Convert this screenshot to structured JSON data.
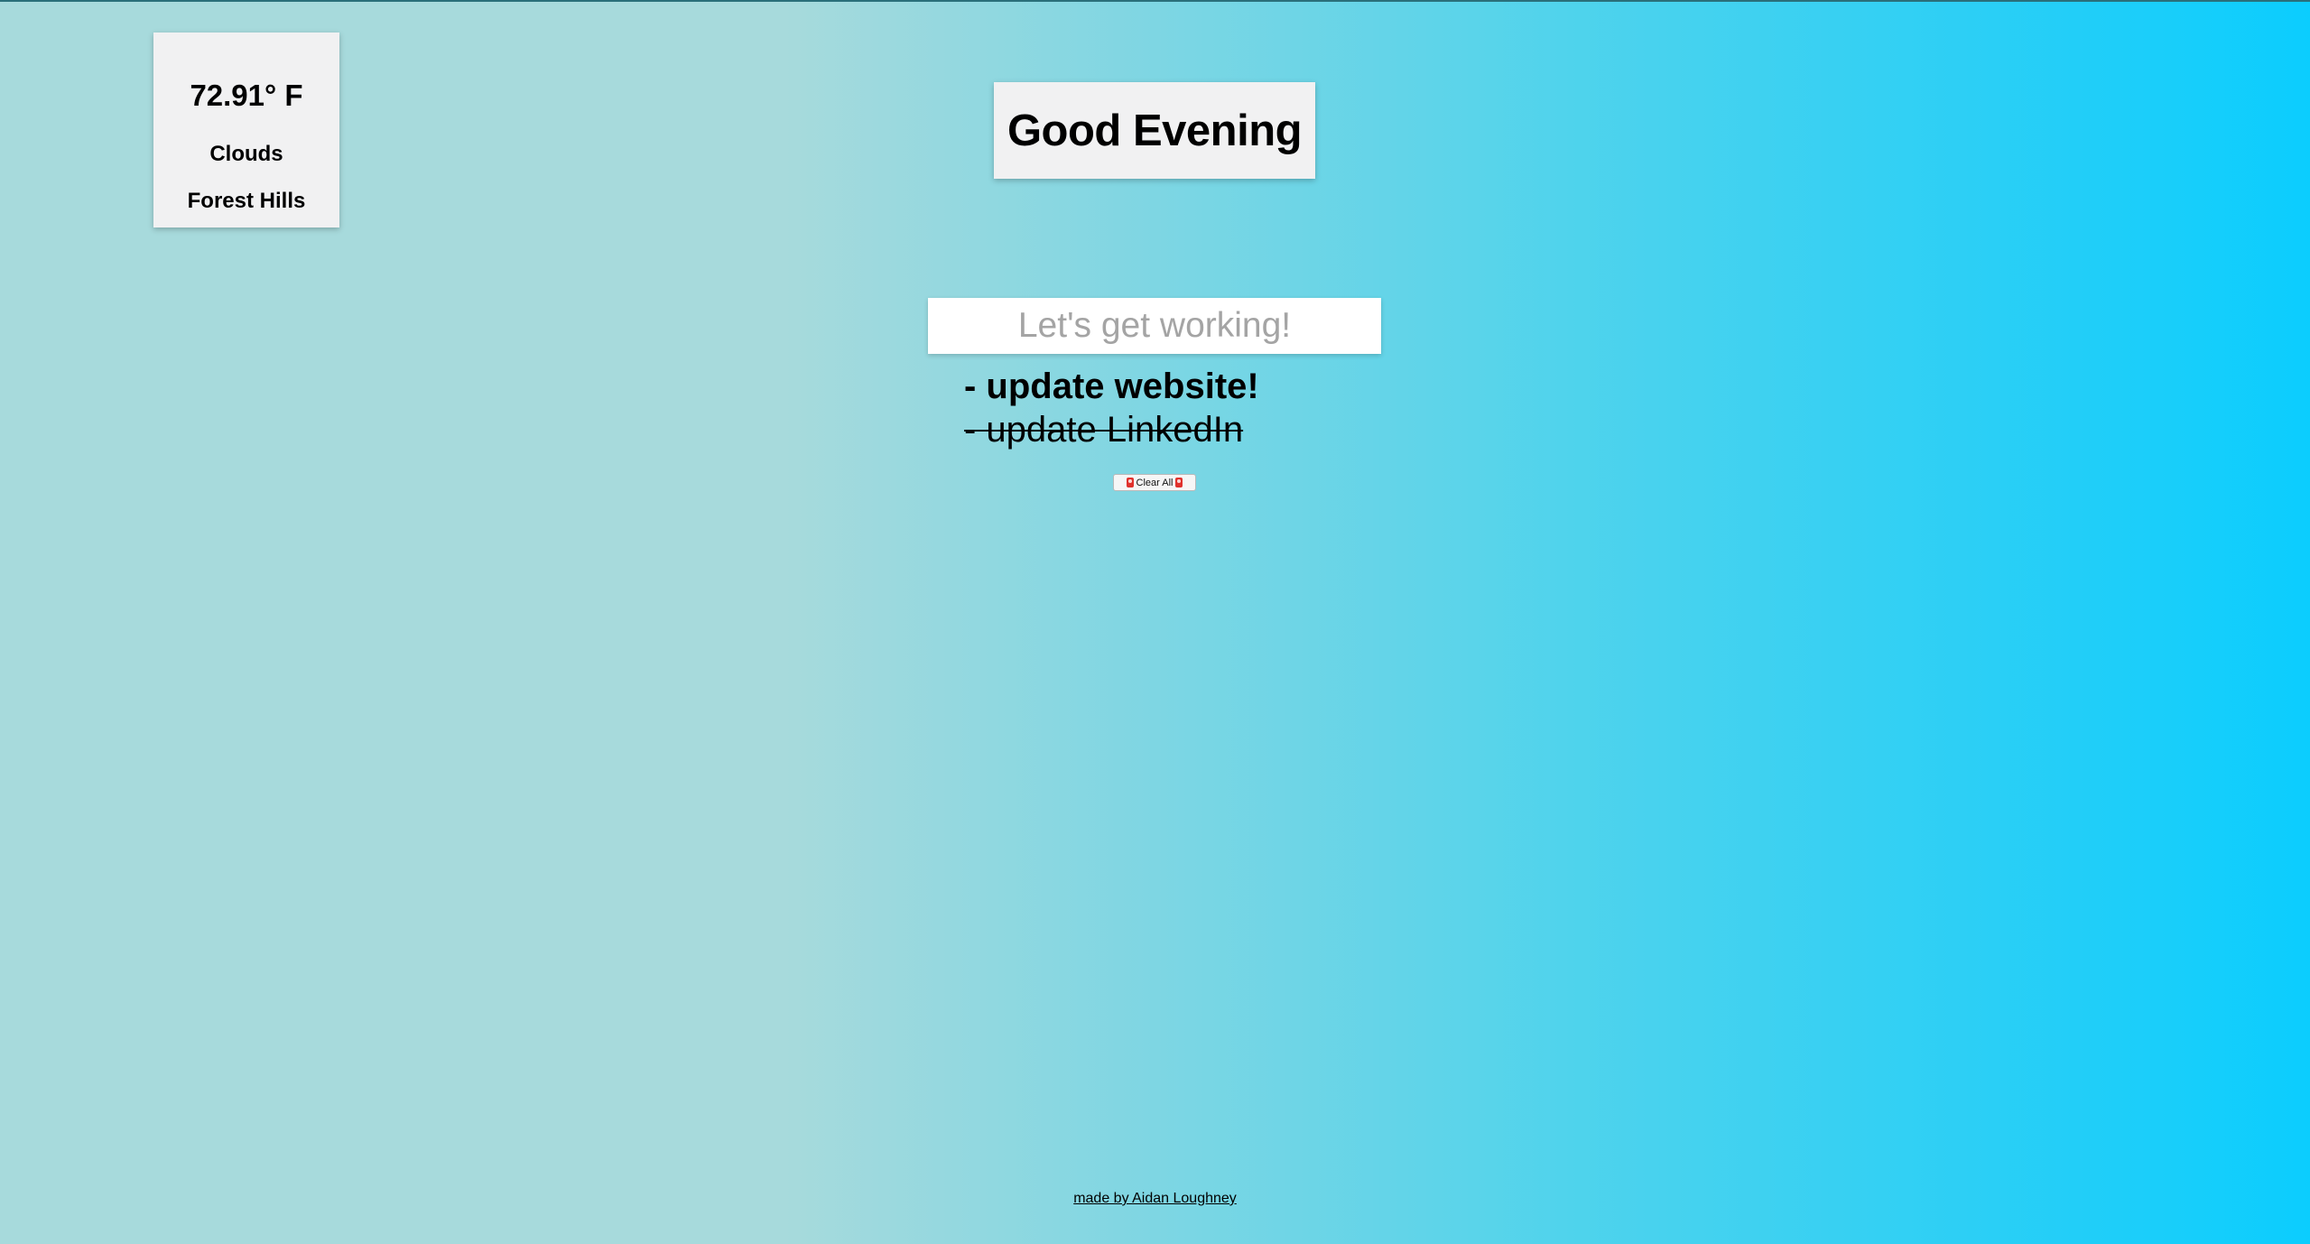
{
  "weather": {
    "temperature": "72.91° F",
    "condition": "Clouds",
    "location": "Forest Hills"
  },
  "greeting": {
    "text": "Good Evening"
  },
  "todo_input": {
    "placeholder": "Let's get working!",
    "value": ""
  },
  "todos": [
    {
      "text": "- update website!",
      "completed": false
    },
    {
      "text": "- update LinkedIn",
      "completed": true
    }
  ],
  "clear_button": {
    "label": "Clear All",
    "icon": "alarm-icon"
  },
  "footer": {
    "credit": "made by Aidan Loughney"
  },
  "colors": {
    "gradient_left": "#a7dadc",
    "gradient_right": "#0bcdfe",
    "card_background": "#f1f1f2"
  }
}
